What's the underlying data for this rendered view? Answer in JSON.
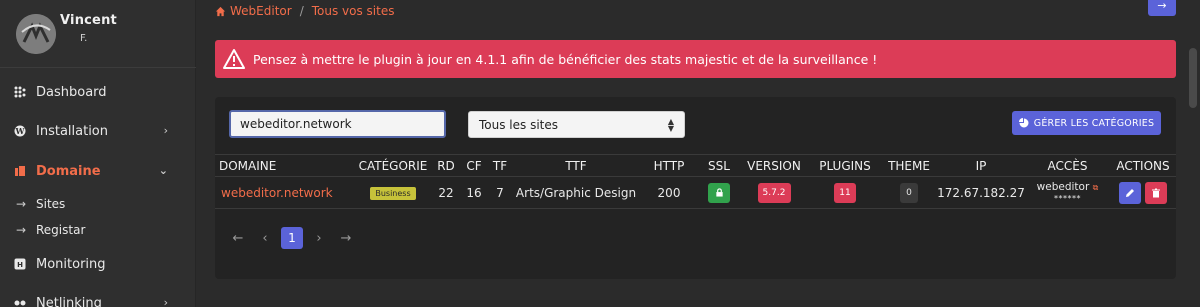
{
  "colors": {
    "accent": "#f26d4a",
    "primary": "#5b63d9",
    "danger": "#dc3c57",
    "success": "#31a24c",
    "badge": "#c6c23a"
  },
  "sidebar": {
    "user_name": "Vincent",
    "user_initial": "F.",
    "items": [
      {
        "label": "Dashboard",
        "icon": "dashboard-icon"
      },
      {
        "label": "Installation",
        "icon": "wordpress-icon"
      },
      {
        "label": "Domaine",
        "icon": "domain-icon"
      },
      {
        "label": "Monitoring",
        "icon": "monitoring-icon"
      },
      {
        "label": "Netlinking",
        "icon": "netlinking-icon"
      }
    ],
    "sub_items": [
      "Sites",
      "Registar"
    ]
  },
  "breadcrumb": {
    "home": "WebEditor",
    "current": "Tous vos sites"
  },
  "alert": {
    "text": "Pensez à mettre le plugin à jour en 4.1.1 afin de bénéficier des stats majestic et de la surveillance !"
  },
  "filters": {
    "search_value": "webeditor.network",
    "select_value": "Tous les sites",
    "categories_button": "GÉRER LES CATÉGORIES"
  },
  "table": {
    "headers": [
      "DOMAINE",
      "CATÉGORIE",
      "RD",
      "CF",
      "TF",
      "TTF",
      "HTTP",
      "SSL",
      "VERSION",
      "PLUGINS",
      "THEME",
      "IP",
      "ACCÈS",
      "ACTIONS"
    ],
    "row": {
      "domain": "webeditor.network",
      "category": "Business",
      "rd": "22",
      "cf": "16",
      "tf": "7",
      "ttf": "Arts/Graphic Design",
      "http": "200",
      "version": "5.7.2",
      "plugins": "11",
      "theme": "0",
      "ip": "172.67.182.27",
      "access_user": "webeditor",
      "access_password": "******"
    }
  },
  "pagination": {
    "current": "1"
  }
}
